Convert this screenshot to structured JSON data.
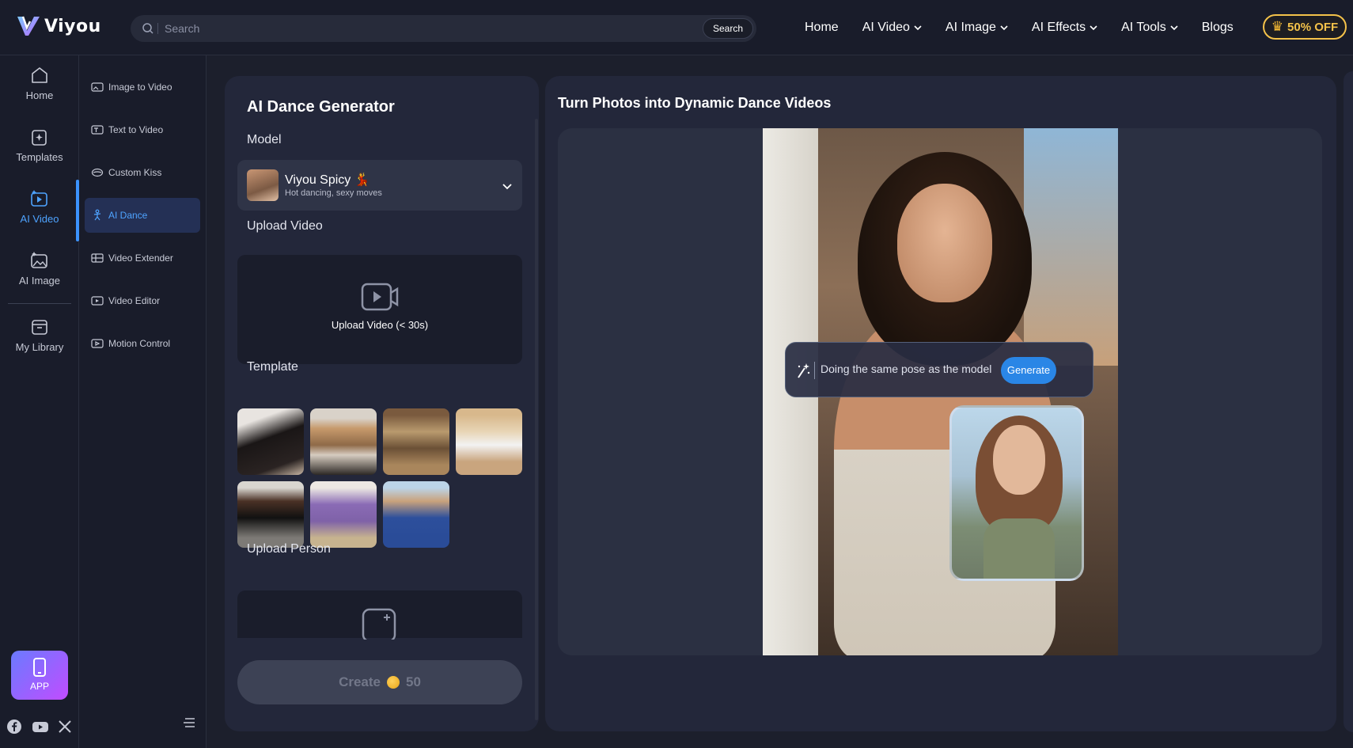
{
  "header": {
    "brand": "Viyou",
    "search": {
      "placeholder": "Search",
      "button": "Search"
    },
    "nav": [
      {
        "label": "Home",
        "dropdown": false
      },
      {
        "label": "AI Video",
        "dropdown": true
      },
      {
        "label": "AI Image",
        "dropdown": true
      },
      {
        "label": "AI Effects",
        "dropdown": true
      },
      {
        "label": "AI Tools",
        "dropdown": true
      },
      {
        "label": "Blogs",
        "dropdown": false
      }
    ],
    "promo": "50% OFF"
  },
  "rail": {
    "items": [
      {
        "label": "Home",
        "icon": "home-icon"
      },
      {
        "label": "Templates",
        "icon": "templates-icon"
      },
      {
        "label": "AI Video",
        "icon": "ai-video-icon",
        "active": true
      },
      {
        "label": "AI Image",
        "icon": "ai-image-icon"
      },
      {
        "label": "My Library",
        "icon": "library-icon"
      }
    ],
    "app_label": "APP"
  },
  "subnav": {
    "items": [
      {
        "label": "Image to Video"
      },
      {
        "label": "Text to Video"
      },
      {
        "label": "Custom Kiss"
      },
      {
        "label": "AI Dance",
        "active": true
      },
      {
        "label": "Video Extender"
      },
      {
        "label": "Video Editor"
      },
      {
        "label": "Motion Control"
      }
    ]
  },
  "panel": {
    "title": "AI Dance Generator",
    "model_label": "Model",
    "model": {
      "name": "Viyou Spicy",
      "emoji": "💃",
      "description": "Hot dancing, sexy moves"
    },
    "upload_video_label": "Upload Video",
    "upload_video_text": "Upload Video (< 30s)",
    "template_label": "Template",
    "upload_person_label": "Upload Person",
    "create_label": "Create",
    "create_cost": "50"
  },
  "preview": {
    "title": "Turn Photos into Dynamic Dance Videos",
    "prompt": "Doing the same pose as the model",
    "generate": "Generate"
  },
  "colors": {
    "background": "#191c2a",
    "panel": "#23273a",
    "accent": "#3b93ff",
    "promo": "#f4c24a"
  }
}
